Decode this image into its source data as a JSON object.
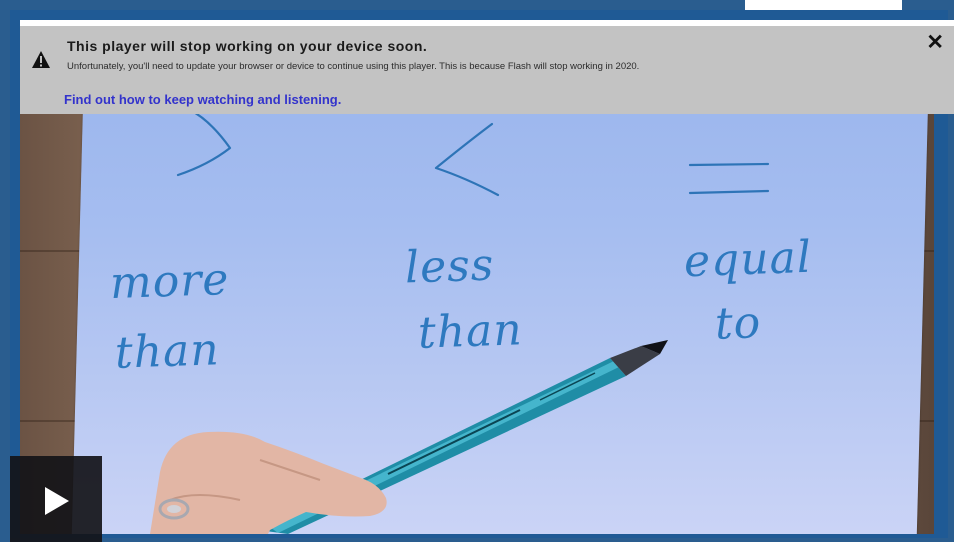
{
  "notice": {
    "title": "This player will stop working on your device soon.",
    "body": "Unfortunately, you'll need to update your browser or device to continue using this player. This is because Flash will stop working in 2020.",
    "link": "Find out how to keep watching and listening.",
    "close_label": "✕"
  },
  "video": {
    "labels": {
      "more_than_line1": "more",
      "more_than_line2": "than",
      "less_than_line1": "less",
      "less_than_line2": "than",
      "equal_to_line1": "equal",
      "equal_to_line2": "to"
    }
  },
  "controls": {
    "play_icon": "play-icon"
  },
  "colors": {
    "notice_bg": "#c3c3c3",
    "link": "#3333cc",
    "ink": "#2e79bf",
    "player_border": "#1f5a95"
  }
}
